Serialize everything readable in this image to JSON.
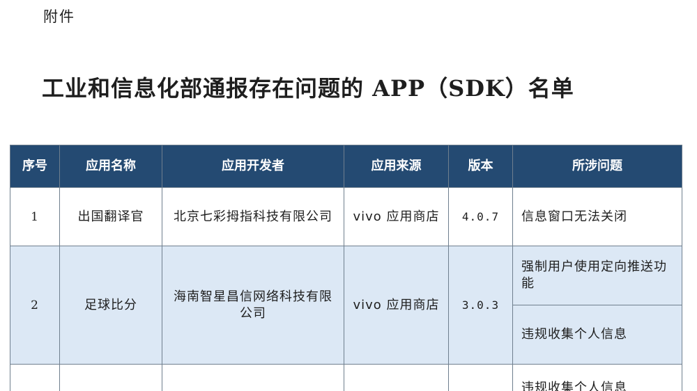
{
  "attachment_label": "附件",
  "title": "工业和信息化部通报存在问题的 APP（SDK）名单",
  "table": {
    "headers": [
      "序号",
      "应用名称",
      "应用开发者",
      "应用来源",
      "版本",
      "所涉问题"
    ],
    "rows": [
      {
        "index": "1",
        "app_name": "出国翻译官",
        "developer": "北京七彩拇指科技有限公司",
        "source": "vivo 应用商店",
        "version": "4.0.7",
        "issues": [
          "信息窗口无法关闭"
        ]
      },
      {
        "index": "2",
        "app_name": "足球比分",
        "developer": "海南智星昌信网络科技有限公司",
        "source": "vivo 应用商店",
        "version": "3.0.3",
        "issues": [
          "强制用户使用定向推送功能",
          "违规收集个人信息"
        ]
      },
      {
        "index": "",
        "app_name": "",
        "developer": "",
        "source": "",
        "version": "",
        "issues": [
          "违规收集个人信息"
        ]
      }
    ]
  },
  "colors": {
    "header_bg": "#244a72",
    "highlight_row_bg": "#dce8f5"
  }
}
